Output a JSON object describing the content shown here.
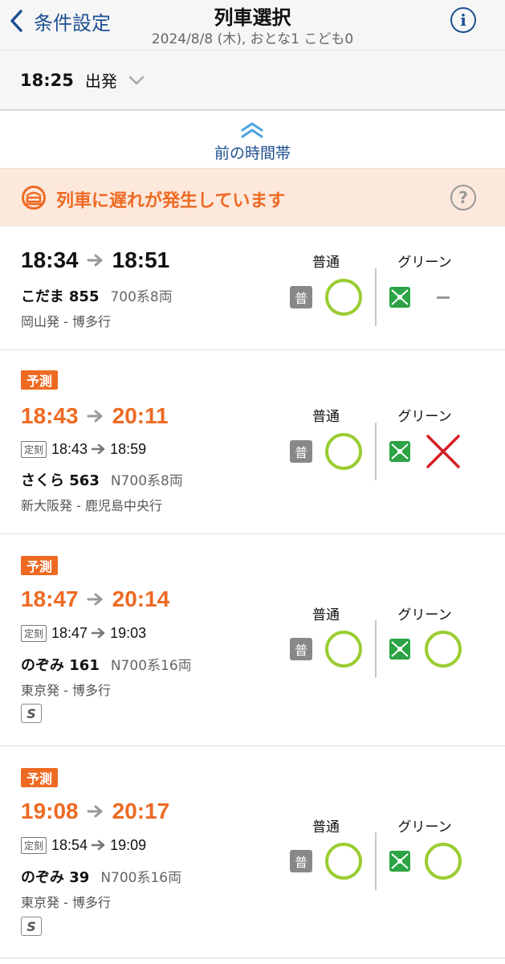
{
  "header": {
    "back_label": "条件設定",
    "title": "列車選択",
    "subtitle": "2024/8/8 (木), おとな1 こども0"
  },
  "departure": {
    "time": "18:25",
    "label": "出発"
  },
  "prev_slot": {
    "label": "前の時間帯"
  },
  "delay_banner": {
    "text": "列車に遅れが発生しています"
  },
  "columns": {
    "ordinary": "普通",
    "green": "グリーン"
  },
  "badges": {
    "predicted": "予測",
    "scheduled": "定刻",
    "ordinary_car": "普",
    "smartex": "S"
  },
  "trains": [
    {
      "dep": "18:34",
      "arr": "18:51",
      "name": "こだま 855",
      "cars": "700系8両",
      "route": "岡山発 - 博多行",
      "ordinary": "available",
      "green": "none"
    },
    {
      "dep": "18:43",
      "arr": "20:11",
      "sched_dep": "18:43",
      "sched_arr": "18:59",
      "name": "さくら 563",
      "cars": "N700系8両",
      "route": "新大阪発 - 鹿児島中央行",
      "ordinary": "available",
      "green": "full"
    },
    {
      "dep": "18:47",
      "arr": "20:14",
      "sched_dep": "18:47",
      "sched_arr": "19:03",
      "name": "のぞみ 161",
      "cars": "N700系16両",
      "route": "東京発 - 博多行",
      "ordinary": "available",
      "green": "available"
    },
    {
      "dep": "19:08",
      "arr": "20:17",
      "sched_dep": "18:54",
      "sched_arr": "19:09",
      "name": "のぞみ 39",
      "cars": "N700系16両",
      "route": "東京発 - 博多行",
      "ordinary": "available",
      "green": "available"
    }
  ],
  "colors": {
    "accent_blue": "#1d4f91",
    "delay_orange": "#ee6a23",
    "available_green": "#9acd32",
    "full_red": "#d61f26"
  }
}
